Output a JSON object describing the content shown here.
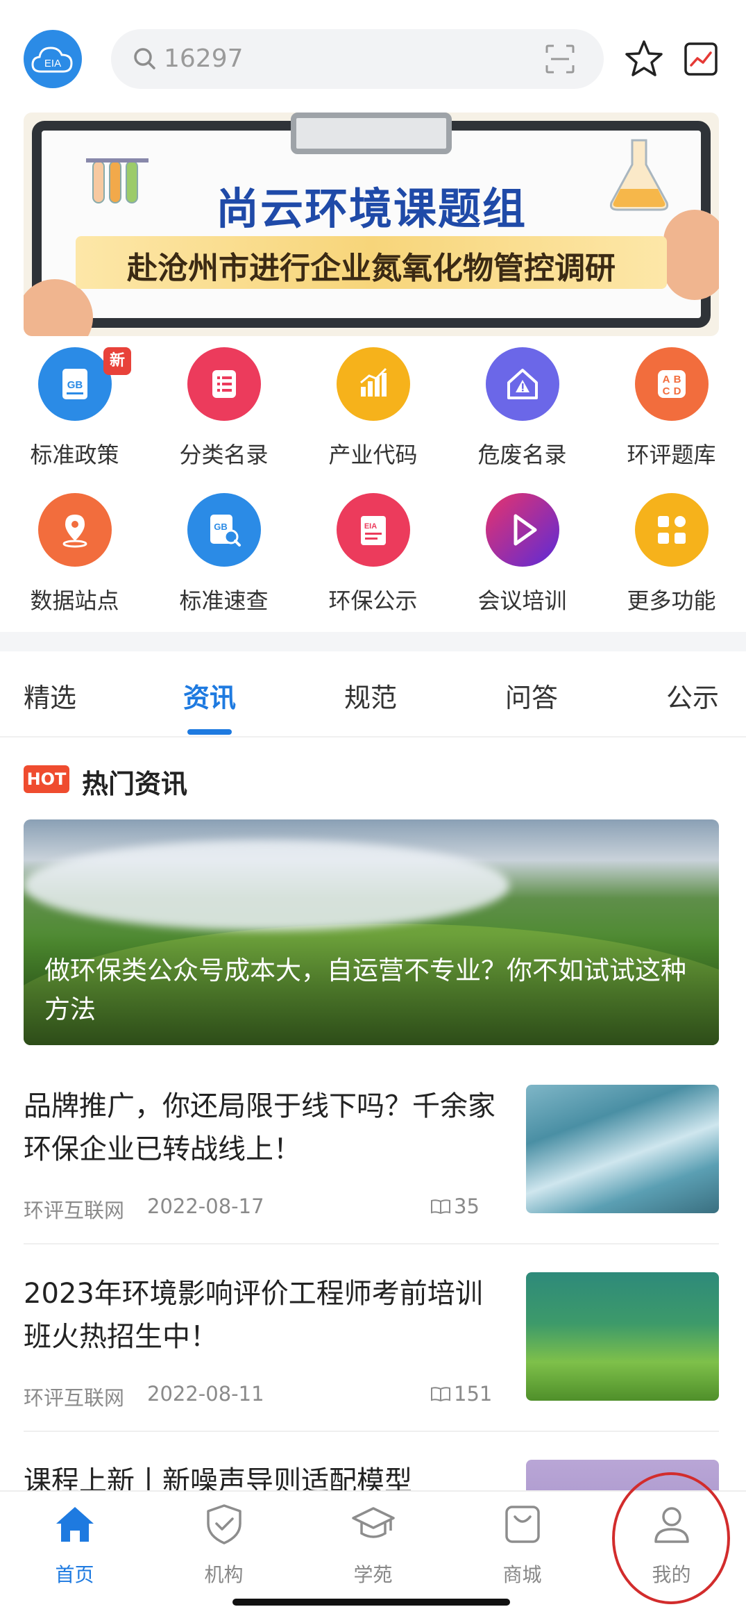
{
  "header": {
    "logo_text": "EIA",
    "search_value": "16297"
  },
  "banner": {
    "title": "尚云环境课题组",
    "subtitle": "赴沧州市进行企业氮氧化物管控调研"
  },
  "quick_grid": {
    "new_badge": "新",
    "items": [
      {
        "label": "标准政策",
        "icon": "gb-document-icon",
        "color": "#2b8be6"
      },
      {
        "label": "分类名录",
        "icon": "list-icon",
        "color": "#ec3b5c"
      },
      {
        "label": "产业代码",
        "icon": "bar-chart-icon",
        "color": "#f6b21b"
      },
      {
        "label": "危废名录",
        "icon": "hazard-house-icon",
        "color": "#6b67e8"
      },
      {
        "label": "环评题库",
        "icon": "abcd-icon",
        "color": "#f26d3d"
      },
      {
        "label": "数据站点",
        "icon": "location-pin-icon",
        "color": "#f26d3d"
      },
      {
        "label": "标准速查",
        "icon": "gb-search-icon",
        "color": "#2b8be6"
      },
      {
        "label": "环保公示",
        "icon": "eia-notice-icon",
        "color": "#ec3b5c"
      },
      {
        "label": "会议培训",
        "icon": "play-triangle-icon",
        "color": "#6b3bd6"
      },
      {
        "label": "更多功能",
        "icon": "more-grid-icon",
        "color": "#f6b21b"
      }
    ]
  },
  "tabs": {
    "items": [
      "精选",
      "资讯",
      "规范",
      "问答",
      "公示"
    ],
    "active": "资讯"
  },
  "hot_section": {
    "badge": "HOT",
    "title": "热门资讯",
    "hero_title": "做环保类公众号成本大，自运营不专业？你不如试试这种方法"
  },
  "news": [
    {
      "title": "品牌推广，你还局限于线下吗？千余家环保企业已转战线上！",
      "source": "环评互联网",
      "date": "2022-08-17",
      "reads": "35"
    },
    {
      "title": "2023年环境影响评价工程师考前培训班火热招生中！",
      "source": "环评互联网",
      "date": "2022-08-11",
      "reads": "151"
    },
    {
      "title": "课程上新丨新噪声导则适配模型",
      "source": "",
      "date": "",
      "reads": ""
    }
  ],
  "bottom_nav": {
    "items": [
      {
        "label": "首页",
        "icon": "home-icon",
        "active": true
      },
      {
        "label": "机构",
        "icon": "shield-check-icon",
        "active": false
      },
      {
        "label": "学苑",
        "icon": "graduation-cap-icon",
        "active": false
      },
      {
        "label": "商城",
        "icon": "shopping-bag-icon",
        "active": false
      },
      {
        "label": "我的",
        "icon": "user-icon",
        "active": false
      }
    ]
  },
  "colors": {
    "accent": "#1e7ae0",
    "hot_badge": "#ef4c2f",
    "annotation_circle": "#d22c2c"
  }
}
